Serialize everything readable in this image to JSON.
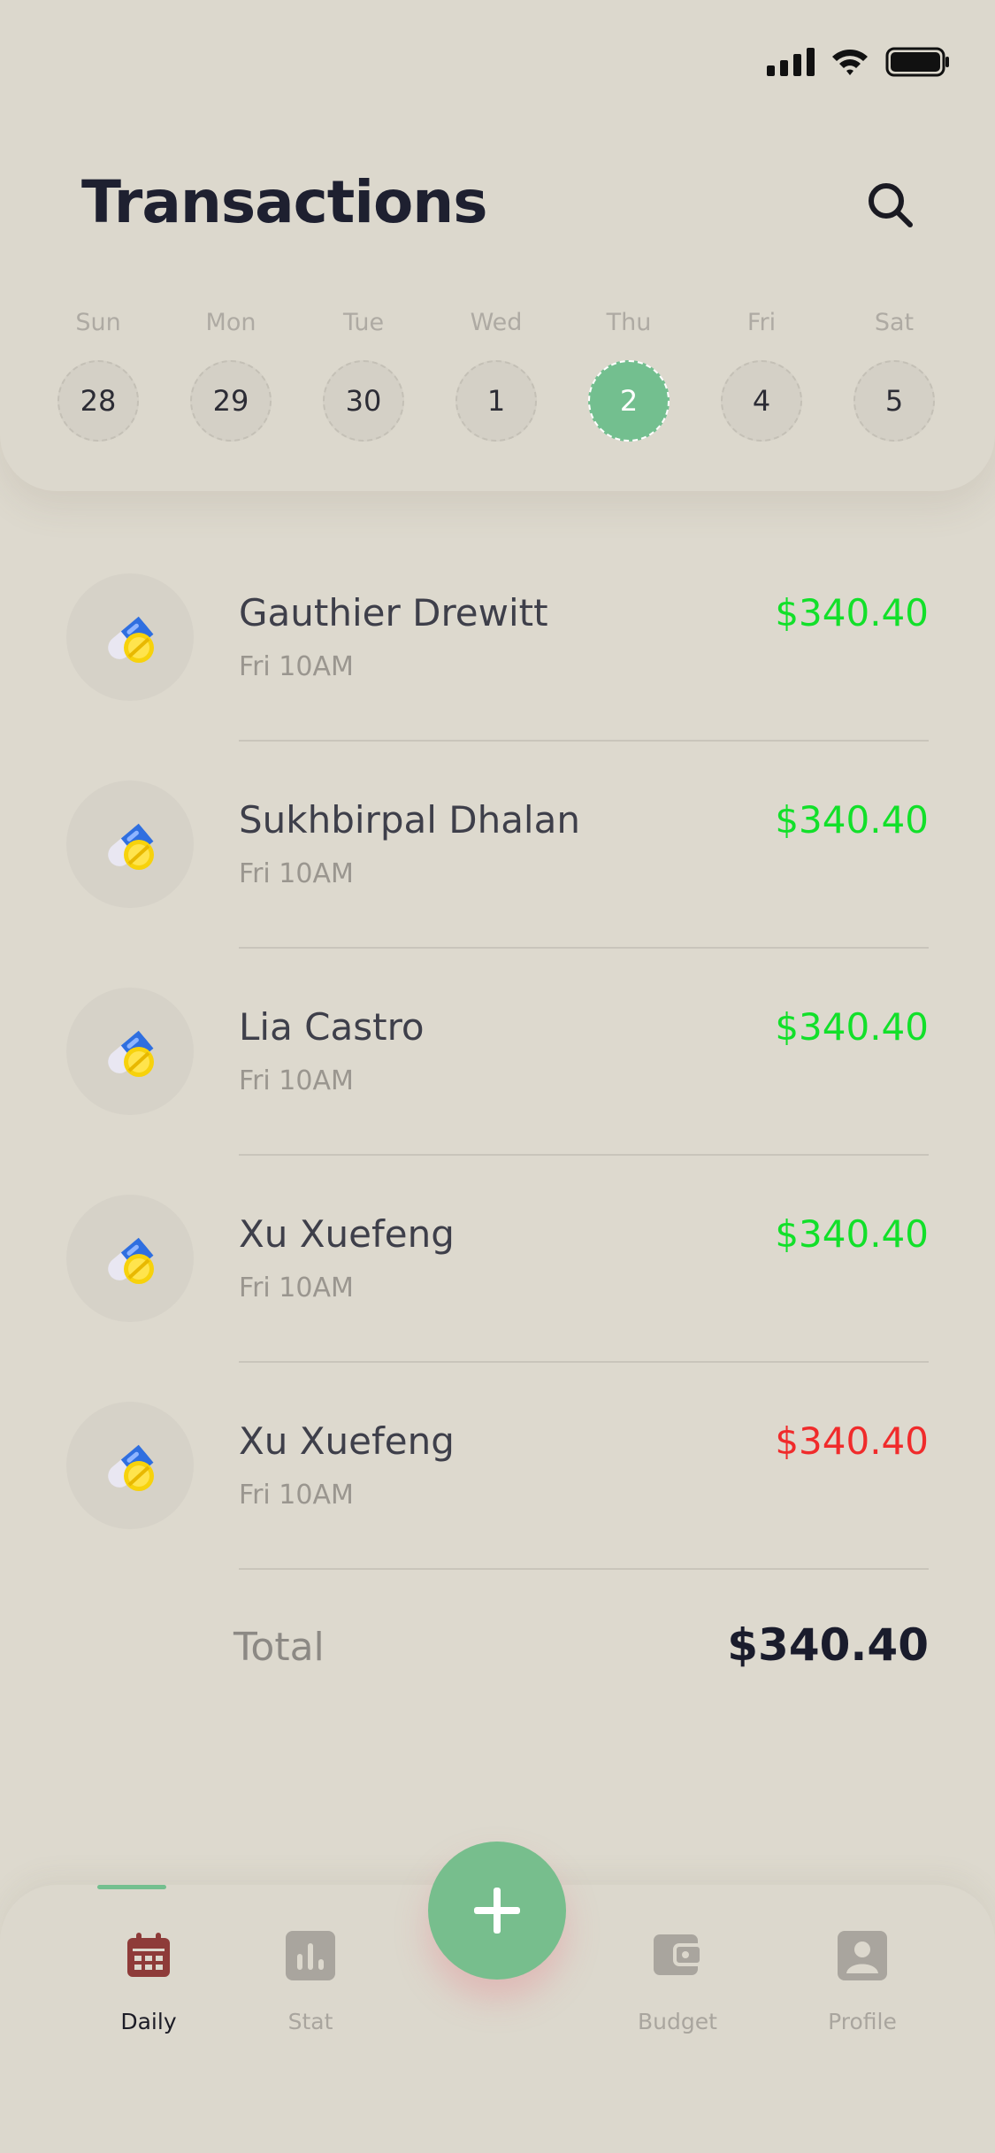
{
  "header": {
    "title": "Transactions",
    "search_icon": "search-icon"
  },
  "week": [
    {
      "name": "Sun",
      "num": "28",
      "selected": false
    },
    {
      "name": "Mon",
      "num": "29",
      "selected": false
    },
    {
      "name": "Tue",
      "num": "30",
      "selected": false
    },
    {
      "name": "Wed",
      "num": "1",
      "selected": false
    },
    {
      "name": "Thu",
      "num": "2",
      "selected": true
    },
    {
      "name": "Fri",
      "num": "4",
      "selected": false
    },
    {
      "name": "Sat",
      "num": "5",
      "selected": false
    }
  ],
  "transactions": [
    {
      "name": "Gauthier Drewitt",
      "time": "Fri 10AM",
      "amount": "$340.40",
      "color": "#12e02a",
      "icon": "pills-icon"
    },
    {
      "name": "Sukhbirpal Dhalan",
      "time": "Fri 10AM",
      "amount": "$340.40",
      "color": "#12e02a",
      "icon": "pills-icon"
    },
    {
      "name": "Lia Castro",
      "time": "Fri 10AM",
      "amount": "$340.40",
      "color": "#12e02a",
      "icon": "pills-icon"
    },
    {
      "name": "Xu Xuefeng",
      "time": "Fri 10AM",
      "amount": "$340.40",
      "color": "#12e02a",
      "icon": "pills-icon"
    },
    {
      "name": "Xu Xuefeng",
      "time": "Fri 10AM",
      "amount": "$340.40",
      "color": "#f02b2b",
      "icon": "pills-icon"
    }
  ],
  "total": {
    "label": "Total",
    "value": "$340.40"
  },
  "nav": [
    {
      "label": "Daily",
      "icon": "calendar-icon",
      "active": true
    },
    {
      "label": "Stat",
      "icon": "stats-icon",
      "active": false
    },
    {
      "label": "Budget",
      "icon": "wallet-icon",
      "active": false
    },
    {
      "label": "Profile",
      "icon": "profile-icon",
      "active": false
    }
  ],
  "fab": {
    "icon": "plus-icon"
  },
  "colors": {
    "accent": "#73bf8f",
    "income": "#12e02a",
    "expense": "#f02b2b",
    "background": "#ddd9ce"
  }
}
